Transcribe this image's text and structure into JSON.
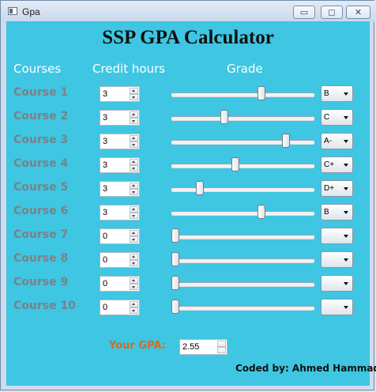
{
  "window": {
    "title": "Gpa",
    "controls": {
      "minimize": "▭",
      "maximize": "◻",
      "close": "✕"
    }
  },
  "app": {
    "title": "SSP GPA Calculator",
    "headers": {
      "courses": "Courses",
      "credit_hours": "Credit hours",
      "grade": "Grade"
    },
    "courses": [
      {
        "name": "Course 1",
        "credit_hours": "3",
        "grade": "B",
        "slider_fraction": 0.63
      },
      {
        "name": "Course 2",
        "credit_hours": "3",
        "grade": "C",
        "slider_fraction": 0.37
      },
      {
        "name": "Course 3",
        "credit_hours": "3",
        "grade": "A-",
        "slider_fraction": 0.8
      },
      {
        "name": "Course 4",
        "credit_hours": "3",
        "grade": "C+",
        "slider_fraction": 0.45
      },
      {
        "name": "Course 5",
        "credit_hours": "3",
        "grade": "D+",
        "slider_fraction": 0.2
      },
      {
        "name": "Course 6",
        "credit_hours": "3",
        "grade": "B",
        "slider_fraction": 0.63
      },
      {
        "name": "Course 7",
        "credit_hours": "0",
        "grade": "",
        "slider_fraction": 0
      },
      {
        "name": "Course 8",
        "credit_hours": "0",
        "grade": "",
        "slider_fraction": 0
      },
      {
        "name": "Course 9",
        "credit_hours": "0",
        "grade": "",
        "slider_fraction": 0
      },
      {
        "name": "Course 10",
        "credit_hours": "0",
        "grade": "",
        "slider_fraction": 0
      }
    ],
    "gpa_label": "Your GPA:",
    "gpa_value": "2.55",
    "footer": "Coded by: Ahmed Hammad"
  },
  "colors": {
    "panel_bg": "#3ec6e3",
    "course_label": "#78828a",
    "gpa_label": "#d86a1c",
    "header_text": "#ffffff"
  },
  "icons": [
    "window-app-icon",
    "minimize-icon",
    "maximize-icon",
    "close-icon",
    "spin-up-icon",
    "spin-down-icon",
    "dropdown-caret-icon"
  ]
}
